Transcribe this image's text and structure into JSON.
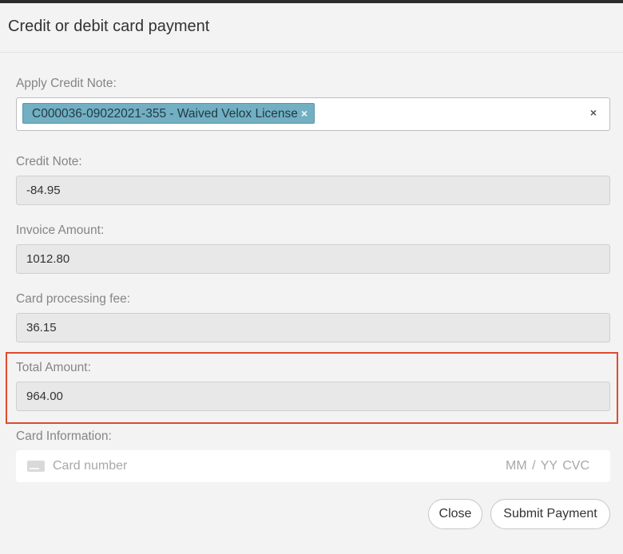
{
  "modal": {
    "title": "Credit or debit card payment"
  },
  "apply_credit_note": {
    "label": "Apply Credit Note:",
    "selected_tag": "C000036-09022021-355 - Waived Velox License",
    "tag_remove": "×",
    "clear_all": "×"
  },
  "credit_note": {
    "label": "Credit Note:",
    "value": "-84.95"
  },
  "invoice_amount": {
    "label": "Invoice Amount:",
    "value": "1012.80"
  },
  "card_processing_fee": {
    "label": "Card processing fee:",
    "value": "36.15"
  },
  "total_amount": {
    "label": "Total Amount:",
    "value": "964.00",
    "highlight_color": "#e04a2f"
  },
  "card_information": {
    "label": "Card Information:",
    "card_number_placeholder": "Card number",
    "expiry_cvc_placeholder": "MM / YY  CVC",
    "icon": "credit-card-icon"
  },
  "footer": {
    "close_label": "Close",
    "submit_label": "Submit Payment"
  }
}
